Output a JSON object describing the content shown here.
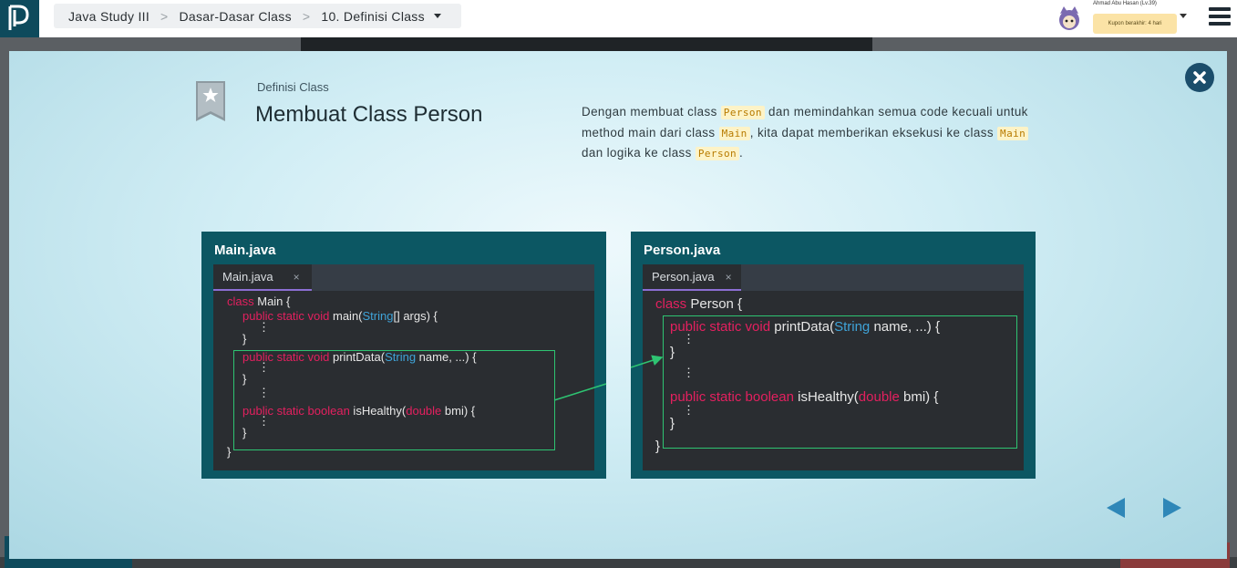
{
  "topbar": {
    "breadcrumb": [
      "Java Study III",
      "Dasar-Dasar Class",
      "10. Definisi Class"
    ],
    "user_name": "Ahmad Abu Hasan (Lv.39)",
    "coupon": "Kupon berakhir: 4 hari"
  },
  "slide": {
    "subtitle": "Definisi Class",
    "title": "Membuat Class Person",
    "desc": {
      "t1": "Dengan membuat class ",
      "c1": "Person",
      "t2": " dan memindahkan semua code kecuali untuk method main dari class ",
      "c2": "Main",
      "t3": ", kita dapat memberikan eksekusi ke class ",
      "c3": "Main",
      "t4": " dan logika ke class ",
      "c4": "Person",
      "t5": "."
    }
  },
  "left_panel": {
    "title": "Main.java",
    "tab": "Main.java",
    "tab_close": "×",
    "code": {
      "l1_kw": "class",
      "l1_rest": " Main {",
      "l2_kw": "public static void",
      "l2_a": " main(",
      "l2_ty": "String",
      "l2_b": "[] args) {",
      "dots": "⋮",
      "brace": "}",
      "l3_kw": "public static void",
      "l3_a": " printData(",
      "l3_ty": "String",
      "l3_b": " name, ...) {",
      "l4_kw": "public static boolean",
      "l4_a": " isHealthy(",
      "l4_ty": "double",
      "l4_b": " bmi) {"
    }
  },
  "right_panel": {
    "title": "Person.java",
    "tab": "Person.java",
    "tab_close": "×",
    "code": {
      "l1_kw": "class",
      "l1_rest": " Person {",
      "l2_kw": "public static void",
      "l2_a": " printData(",
      "l2_ty": "String",
      "l2_b": " name, ...) {",
      "dots": "⋮",
      "brace": "}",
      "l3_kw": "public static boolean",
      "l3_a": " isHealthy(",
      "l3_ty": "double",
      "l3_b": " bmi) {"
    }
  },
  "colors": {
    "keyword": "#e3205f",
    "type": "#3fa3d8",
    "highlight": "#2ec472",
    "panel": "#0c5763",
    "nav_arrow": "#2f87b8"
  },
  "icons": {
    "logo": "progate-logo-icon",
    "bookmark": "bookmark-star-icon",
    "close": "close-circle-icon",
    "prev": "prev-arrow-icon",
    "next": "next-arrow-icon",
    "menu": "hamburger-menu-icon"
  }
}
